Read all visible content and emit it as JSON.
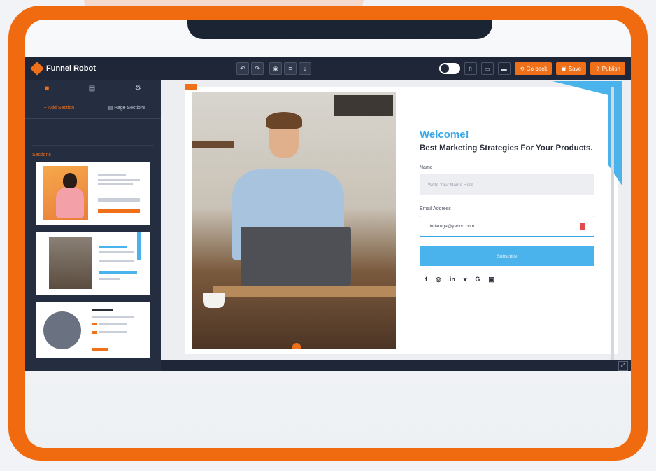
{
  "app": {
    "name": "Funnel Robot"
  },
  "toolbar": {
    "undo_icon": "undo-icon",
    "redo_icon": "redo-icon",
    "buttons": [
      {
        "label": "Go back",
        "icon": "back-icon"
      },
      {
        "label": "Save",
        "icon": "save-icon"
      },
      {
        "label": "Publish",
        "icon": "publish-icon"
      }
    ],
    "accent": "#f0701a"
  },
  "sidebar": {
    "tabs": [
      "Add Section",
      "Page Sections"
    ],
    "section_title": "Sections"
  },
  "form": {
    "welcome": "Welcome!",
    "headline": "Best Marketing Strategies For Your Products.",
    "name_label": "Name",
    "name_placeholder": "Write Your Name Here",
    "email_label": "Email Address",
    "email_value": "lindaruga@yahoo.com",
    "submit_label": "Subscribe",
    "social_icons": [
      "facebook-icon",
      "instagram-icon",
      "linkedin-icon",
      "twitter-icon",
      "google-icon",
      "youtube-icon"
    ],
    "accent": "#3aa8e8"
  }
}
